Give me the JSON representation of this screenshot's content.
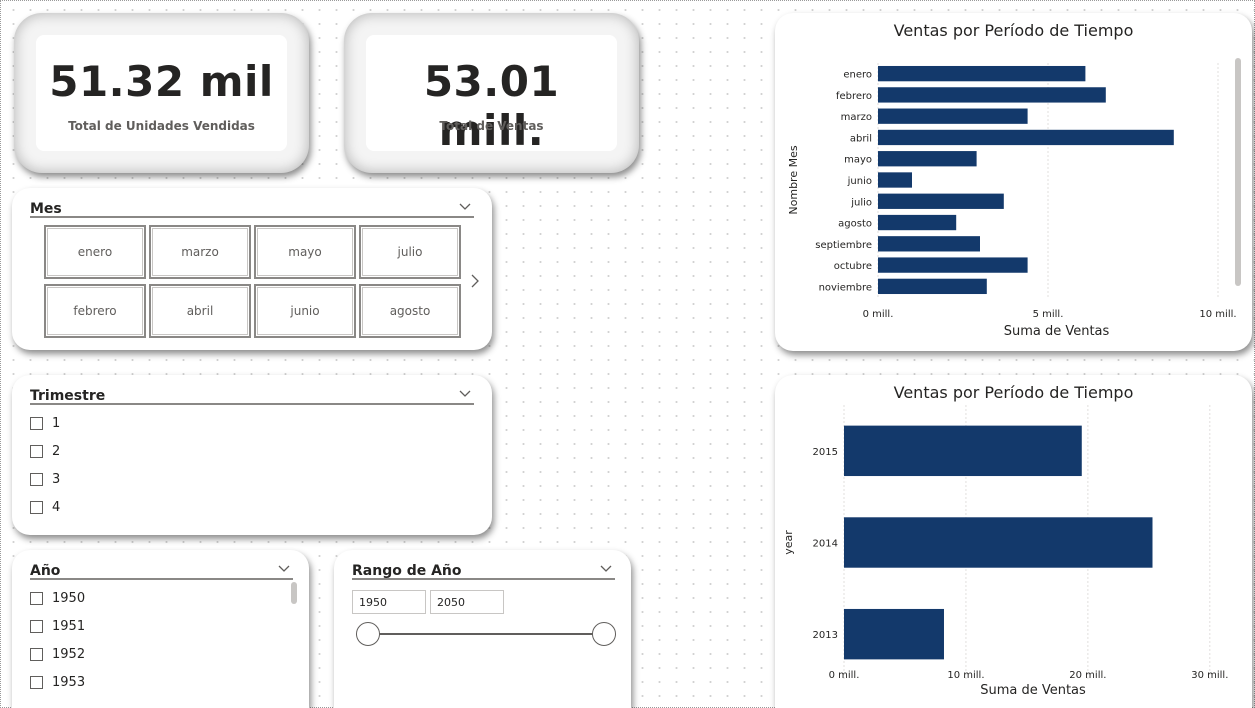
{
  "kpi": {
    "units": {
      "value": "51.32 mil",
      "label": "Total de Unidades Vendidas"
    },
    "sales": {
      "value": "53.01 mill.",
      "label": "Total de Ventas"
    }
  },
  "mes_slicer": {
    "title": "Mes",
    "tiles": [
      "enero",
      "marzo",
      "mayo",
      "julio",
      "febrero",
      "abril",
      "junio",
      "agosto"
    ]
  },
  "trimestre_slicer": {
    "title": "Trimestre",
    "items": [
      "1",
      "2",
      "3",
      "4"
    ]
  },
  "anio_slicer": {
    "title": "Año",
    "items": [
      "1950",
      "1951",
      "1952",
      "1953"
    ]
  },
  "rango_slicer": {
    "title": "Rango de Año",
    "from": "1950",
    "to": "2050"
  },
  "colors": {
    "bar": "#13396b",
    "grid": "#e1dfdd",
    "text": "#252423"
  },
  "chart_data": [
    {
      "type": "bar",
      "orientation": "horizontal",
      "title": "Ventas por Período de Tiempo",
      "xlabel": "Suma de Ventas",
      "ylabel": "Nombre Mes",
      "categories": [
        "enero",
        "febrero",
        "marzo",
        "abril",
        "mayo",
        "junio",
        "julio",
        "agosto",
        "septiembre",
        "octubre",
        "noviembre"
      ],
      "values": [
        6.1,
        6.7,
        4.4,
        8.7,
        2.9,
        1.0,
        3.7,
        2.3,
        3.0,
        4.4,
        3.2
      ],
      "xlim": [
        0,
        10.5
      ],
      "xticks": [
        0,
        5,
        10
      ],
      "xtick_labels": [
        "0 mill.",
        "5 mill.",
        "10 mill."
      ],
      "grid": true
    },
    {
      "type": "bar",
      "orientation": "horizontal",
      "title": "Ventas por Período de Tiempo",
      "xlabel": "Suma de Ventas",
      "ylabel": "year",
      "categories": [
        "2015",
        "2014",
        "2013"
      ],
      "values": [
        19.5,
        25.3,
        8.2
      ],
      "xlim": [
        0,
        31
      ],
      "xticks": [
        0,
        10,
        20,
        30
      ],
      "xtick_labels": [
        "0 mill.",
        "10 mill.",
        "20 mill.",
        "30 mill."
      ],
      "grid": true
    }
  ]
}
